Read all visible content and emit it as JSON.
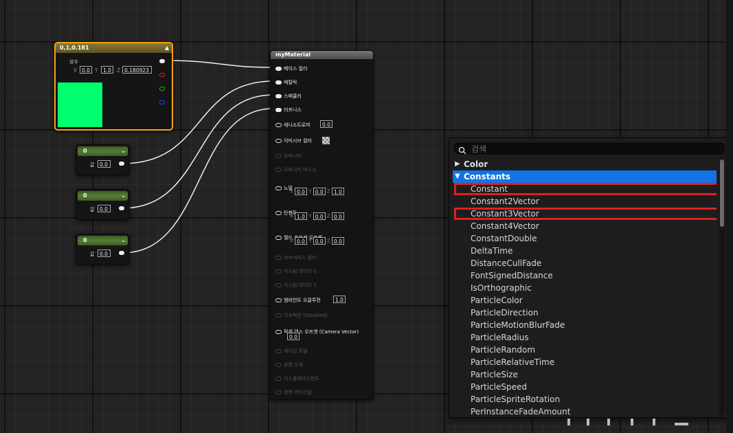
{
  "canvas": {
    "background": "#232323"
  },
  "vector_node": {
    "title": "0,1,0.181",
    "collapse_icon": "chevron-up-icon",
    "param_label": "상수",
    "x_label": "X",
    "x_value": "0.0",
    "y_label": "Y",
    "y_value": "1.0",
    "z_label": "Z",
    "z_value": "0.180923",
    "color": "#00ff6e",
    "pins": {
      "rgb": "#eeeeee",
      "r": "#e02020",
      "g": "#20c020",
      "b": "#2040ff"
    }
  },
  "scalar_nodes": [
    {
      "title": "0",
      "label": "값",
      "value": "0.0"
    },
    {
      "title": "0",
      "label": "값",
      "value": "0.0"
    },
    {
      "title": "0",
      "label": "값",
      "value": "0.0"
    }
  ],
  "material_node": {
    "title": "myMaterial",
    "base_color": "베이스 컬러",
    "metallic": "메탈릭",
    "specular": "스페큘러",
    "roughness": "러프니스",
    "anisotropy": "애니소트로피",
    "anisotropy_value": "0.0",
    "emissive": "이미시브 컬러",
    "opacity": "오파시티",
    "opacity_mask": "오파시티 마스크",
    "normal": "노멀",
    "normal_x": "0.0",
    "normal_y": "0.0",
    "normal_z": "1.0",
    "tangent": "탄젠트",
    "tangent_x": "1.0",
    "tangent_y": "0.0",
    "tangent_z": "0.0",
    "wpo": "월드 포지션 오프셋",
    "wpo_x": "0.0",
    "wpo_y": "0.0",
    "wpo_z": "0.0",
    "subsurface": "서브서피스 컬러",
    "custom0": "커스텀 데이터 0",
    "custom1": "커스텀 데이터 1",
    "ao": "앰비언트 오클루전",
    "ao_value": "1.0",
    "refraction": "리프랙션 (Disabled)",
    "pdo": "픽셀 뎁스 오프셋 (Camera Vector)",
    "pdo_value": "0.0",
    "shading_model": "셰이딩 모델",
    "surface_thickness": "표면 두께",
    "displacement": "디스플레이스먼트",
    "front_material": "정면 머티리얼",
    "x_label": "X",
    "y_label": "Y",
    "z_label": "Z"
  },
  "menu": {
    "search_placeholder": "검색",
    "search_icon": "search-icon",
    "categories": [
      {
        "label": "Color",
        "expanded": false
      },
      {
        "label": "Constants",
        "expanded": true
      }
    ],
    "items": [
      "Constant",
      "Constant2Vector",
      "Constant3Vector",
      "Constant4Vector",
      "ConstantDouble",
      "DeltaTime",
      "DistanceCullFade",
      "FontSignedDistance",
      "IsOrthographic",
      "ParticleColor",
      "ParticleDirection",
      "ParticleMotionBlurFade",
      "ParticleRadius",
      "ParticleRandom",
      "ParticleRelativeTime",
      "ParticleSize",
      "ParticleSpeed",
      "ParticleSpriteRotation",
      "PerInstanceFadeAmount"
    ],
    "selected_color": "#1174e6",
    "highlight_color": "#e02020"
  }
}
